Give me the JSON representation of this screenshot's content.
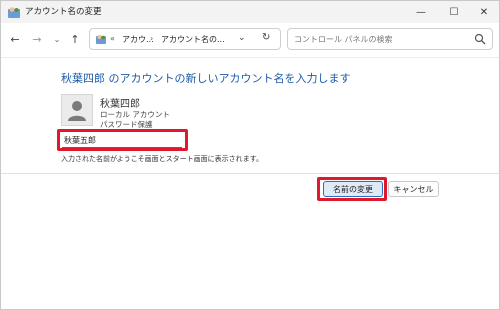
{
  "window": {
    "title": "アカウント名の変更",
    "controls": {
      "minimize": "—",
      "maximize": "☐",
      "close": "✕"
    }
  },
  "nav": {
    "back": "←",
    "forward": "→",
    "history": "⌄",
    "up": "↑",
    "address": {
      "overflow": "«",
      "crumb1": "アカウ...",
      "separator": "›",
      "crumb2": "アカウント名の...",
      "dropdown": "⌄",
      "refresh": "↻"
    },
    "search": {
      "placeholder": "コントロール パネルの検索"
    }
  },
  "main": {
    "heading": "秋葉四郎 のアカウントの新しいアカウント名を入力します",
    "account": {
      "name": "秋葉四郎",
      "type": "ローカル アカウント",
      "password": "パスワード保護"
    },
    "new_name": {
      "value": "秋葉五郎"
    },
    "note": "入力された名前がようこそ画面とスタート画面に表示されます。",
    "buttons": {
      "rename": "名前の変更",
      "cancel": "キャンセル"
    }
  },
  "colors": {
    "heading": "#1e5aa8",
    "highlight": "#e0182d",
    "primary_button_bg": "#dfeaf7",
    "primary_button_border": "#2b6fc2",
    "input_underline": "#1a6fd6"
  },
  "icons": {
    "app": "user-accounts-icon",
    "address": "user-accounts-icon",
    "search": "search-icon",
    "avatar": "user-avatar-icon"
  }
}
